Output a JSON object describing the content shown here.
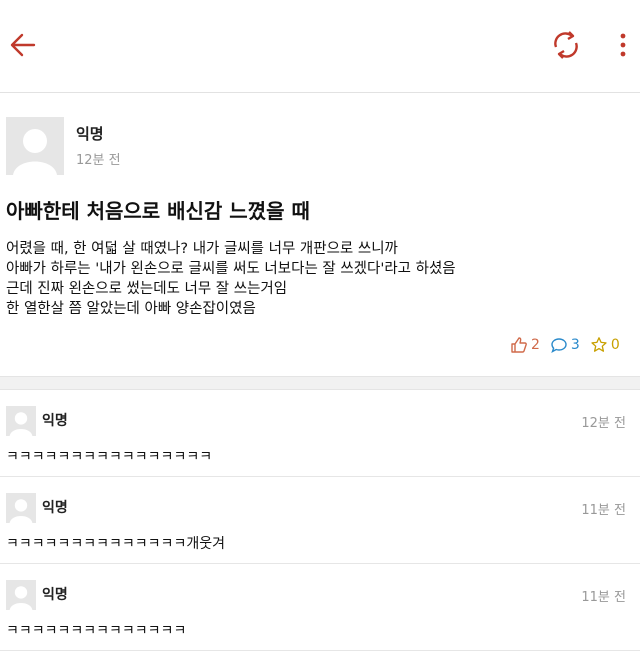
{
  "post": {
    "author": "익명",
    "time": "12분 전",
    "title": "아빠한테 처음으로 배신감 느꼈을 때",
    "body_lines": [
      "어렸을 때, 한 여덟 살 때였나? 내가 글씨를 너무 개판으로 쓰니까",
      "아빠가 하루는 '내가 왼손으로 글씨를 써도 너보다는 잘 쓰겠다'라고 하셨음",
      "근데 진짜 왼손으로 썼는데도 너무 잘 쓰는거임",
      "한 열한살 쯤 알았는데 아빠 양손잡이였음"
    ],
    "likes": "2",
    "comments": "3",
    "favorites": "0"
  },
  "comments": [
    {
      "author": "익명",
      "time": "12분 전",
      "text": "ㅋㅋㅋㅋㅋㅋㅋㅋㅋㅋㅋㅋㅋㅋㅋㅋ"
    },
    {
      "author": "익명",
      "time": "11분 전",
      "text": "ㅋㅋㅋㅋㅋㅋㅋㅋㅋㅋㅋㅋㅋㅋ개웃겨"
    },
    {
      "author": "익명",
      "time": "11분 전",
      "text": "ㅋㅋㅋㅋㅋㅋㅋㅋㅋㅋㅋㅋㅋㅋ"
    }
  ],
  "colors": {
    "accent": "#c0392b"
  },
  "icons": {
    "back": "arrow-left-icon",
    "refresh": "refresh-icon",
    "more": "more-vertical-icon"
  }
}
